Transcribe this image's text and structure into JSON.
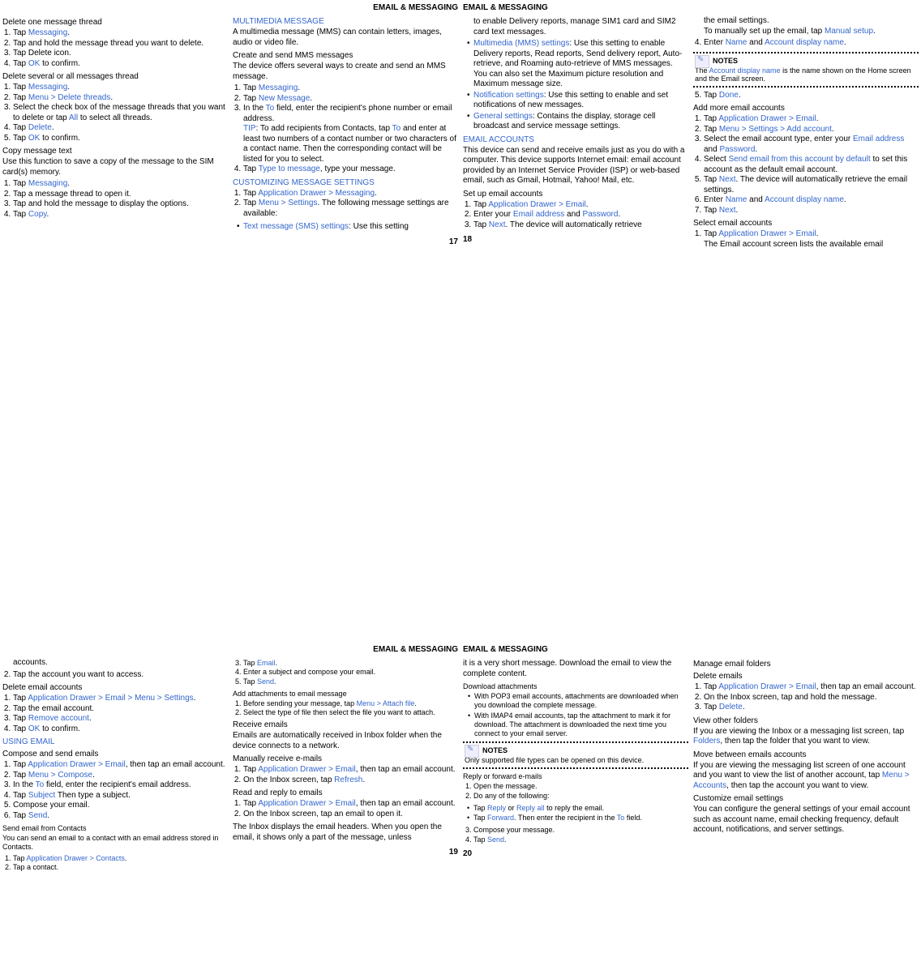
{
  "section_header": "EMAIL & MESSAGING",
  "notes_label": "NOTES",
  "p17": {
    "col1": {
      "h1": "Delete one message thread",
      "l1": [
        "Tap <link>Messaging</link>.",
        "Tap and hold the message thread you want to delete.",
        "Tap Delete icon.",
        "Tap <link>OK</link> to confirm."
      ],
      "h2": "Delete several or all messages thread",
      "l2": [
        "Tap <link>Messaging</link>.",
        "Tap <link>Menu > Delete threads</link>.",
        "Select the check box of the message threads that you want to delete or tap <link>All</link> to select all threads.",
        "Tap <link>Delete</link>.",
        "Tap <link>OK</link> to confirm."
      ],
      "h3": "Copy message text",
      "p3": "Use this function to save a copy of the message to the SIM card(s) memory.",
      "l3": [
        "Tap <link>Messaging</link>.",
        "Tap a message thread to open it.",
        "Tap and hold the message to display the options.",
        "Tap <link>Copy</link>."
      ]
    },
    "col2": {
      "h1": "MULTIMEDIA MESSAGE",
      "p1": "A multimedia message (MMS) can contain letters, images, audio or video file.",
      "h2": "Create and send MMS messages",
      "p2": "The device offers several ways to create and send an MMS message.",
      "l2": [
        "Tap <link>Messaging</link>.",
        "Tap <link>New Message</link>.",
        "In the <link>To</link> field, enter the recipient's phone number or email address.<br><link>TIP</link>: To add recipients from Contacts, tap <link>To</link> and enter at least two numbers of a contact number or two characters of a contact name. Then the corresponding contact will be listed for you to select.",
        "Tap <link>Type to message</link>, type your message."
      ],
      "h3": "CUSTOMIZING MESSAGE SETTINGS",
      "l3": [
        "Tap <link>Application Drawer > Messaging</link>.",
        "Tap <link>Menu > Settings</link>. The following message settings are available:"
      ],
      "b3": [
        "<link>Text message (SMS) settings</link>: Use this setting"
      ]
    },
    "num": "17"
  },
  "p18": {
    "col1": {
      "p0": "to enable Delivery reports, manage SIM1 card and SIM2 card text messages.",
      "b0": [
        "<link>Multimedia (MMS) settings</link>: Use this setting to enable Delivery reports, Read reports, Send delivery report, Auto-retrieve, and Roaming auto-retrieve of MMS messages. You can also set the Maximum picture resolution and Maximum message size.",
        "<link>Notification settings</link>: Use this setting to enable and set notifications of new messages.",
        "<link>General settings</link>: Contains the display, storage cell broadcast and service message settings."
      ],
      "h1": "EMAIL ACCOUNTS",
      "p1": "This device can send and receive emails just as you do with a computer. This device supports Internet email: email account provided by an Internet Service Provider (ISP) or web-based email, such as Gmail, Hotmail, Yahoo! Mail, etc.",
      "h2": "Set up email accounts",
      "l2": [
        "Tap <link>Application Drawer > Email</link>.",
        "Enter your <link>Email address</link> and <link>Password</link>.",
        "Tap <link>Next</link>. The device will automatically retrieve"
      ]
    },
    "col2": {
      "p0": "the email settings.<br>To manually set up the email, tap <link>Manual setup</link>.",
      "l0": [
        "Enter <link>Name</link> and <link>Account display name</link>."
      ],
      "note": "The <link>Account display name</link> is the name shown on the Home screen and the Email screen.",
      "l1": [
        "Tap <link>Done</link>."
      ],
      "h2": "Add more email accounts",
      "l2": [
        "Tap <link>Application Drawer > Email</link>.",
        "Tap <link>Menu > Settings > Add account</link>.",
        "Select the email account type, enter your <link>Email address</link> and <link>Password</link>.",
        "Select <link>Send email from this account by default</link> to set this account as the default email account.",
        "Tap <link>Next</link>. The device will automatically retrieve the email settings.",
        "Enter <link>Name</link> and <link>Account display name</link>.",
        "Tap <link>Next</link>."
      ],
      "h3": "Select email accounts",
      "l3": [
        "Tap <link>Application Drawer > Email</link>.<br>The Email account screen lists the available email"
      ]
    },
    "num": "18"
  },
  "p19": {
    "col1": {
      "p0": "accounts.",
      "l0": [
        "Tap the account you want to access."
      ],
      "h1": "Delete email accounts",
      "l1": [
        "Tap <link>Application Drawer > Email > Menu > Settings</link>.",
        "Tap the email account.",
        "Tap <link>Remove account</link>.",
        "Tap <link>OK</link> to confirm."
      ],
      "h2": "USING EMAIL",
      "h3": "Compose and send emails",
      "l3": [
        "Tap <link>Application Drawer > Email</link>, then tap an email account.",
        "Tap <link>Menu > Compose</link>.",
        "In the <link>To</link> field, enter the recipient's email address.",
        "Tap <link>Subject</link> Then type a subject.",
        "Compose your email.",
        "Tap <link>Send</link>."
      ],
      "h4": "Send email from Contacts",
      "p4": "You can send an email to a contact with an email address stored in Contacts.",
      "l4": [
        "Tap <link>Application Drawer > Contacts</link>.",
        "Tap a contact."
      ]
    },
    "col2": {
      "l0": [
        "Tap <link>Email</link>.",
        "Enter a subject and compose your email.",
        "Tap <link>Send</link>."
      ],
      "h1": "Add attachments to email message",
      "l1": [
        "Before sending your message, tap <link>Menu > Attach file</link>.",
        "Select the type of file then select the file you want to attach."
      ],
      "h2": "Receive emails",
      "p2": "Emails are automatically received in Inbox folder when the device connects to a network.",
      "h3": "Manually receive e-mails",
      "l3": [
        "Tap <link>Application Drawer > Email</link>, then tap an email account.",
        "On the Inbox screen, tap <link>Refresh</link>."
      ],
      "h4": "Read and reply to emails",
      "l4": [
        "Tap <link>Application Drawer > Email</link>, then tap an email account.",
        "On the Inbox screen, tap an email to open it."
      ],
      "p5": "The Inbox displays the email headers. When you open the email, it shows only a part of the message, unless"
    },
    "num": "19"
  },
  "p20": {
    "col1": {
      "p0": "it is a very short message. Download the email to view the complete content.",
      "h1": "Download attachments",
      "b1": [
        "With POP3 email accounts, attachments are downloaded when you download the complete message.",
        "With IMAP4 email accounts, tap the attachment to mark it for download. The attachment is downloaded the next time you connect to your email server."
      ],
      "note": "Only supported file types can be opened on this device.",
      "h2": "Reply or forward e-mails",
      "l2": [
        "Open the message.",
        "Do any of the following:"
      ],
      "b2": [
        "Tap <link>Reply</link> or <link>Reply all</link> to reply the email.",
        "Tap <link>Forward</link>. Then enter the recipient in the <link>To</link> field."
      ],
      "l3": [
        "Compose your message.",
        "Tap <link>Send</link>."
      ]
    },
    "col2": {
      "h1": "Manage email folders",
      "h2": "Delete emails",
      "l2": [
        "Tap <link>Application Drawer > Email</link>, then tap an email account.",
        "On the Inbox screen, tap and hold the message.",
        "Tap <link>Delete</link>."
      ],
      "h3": "View other folders",
      "p3": "If you are viewing the Inbox or a messaging list screen, tap <link>Folders</link>, then tap the folder that you want to view.",
      "h4": "Move between emails accounts",
      "p4": "If you are viewing the messaging list screen of one account and you want to view the list of another account, tap <link>Menu > Accounts</link>, then tap the account you want to view.",
      "h5": "Customize email settings",
      "p5": "You can configure the general settings of your email account such as account name, email checking frequency, default account, notifications, and server settings."
    },
    "num": "20"
  }
}
